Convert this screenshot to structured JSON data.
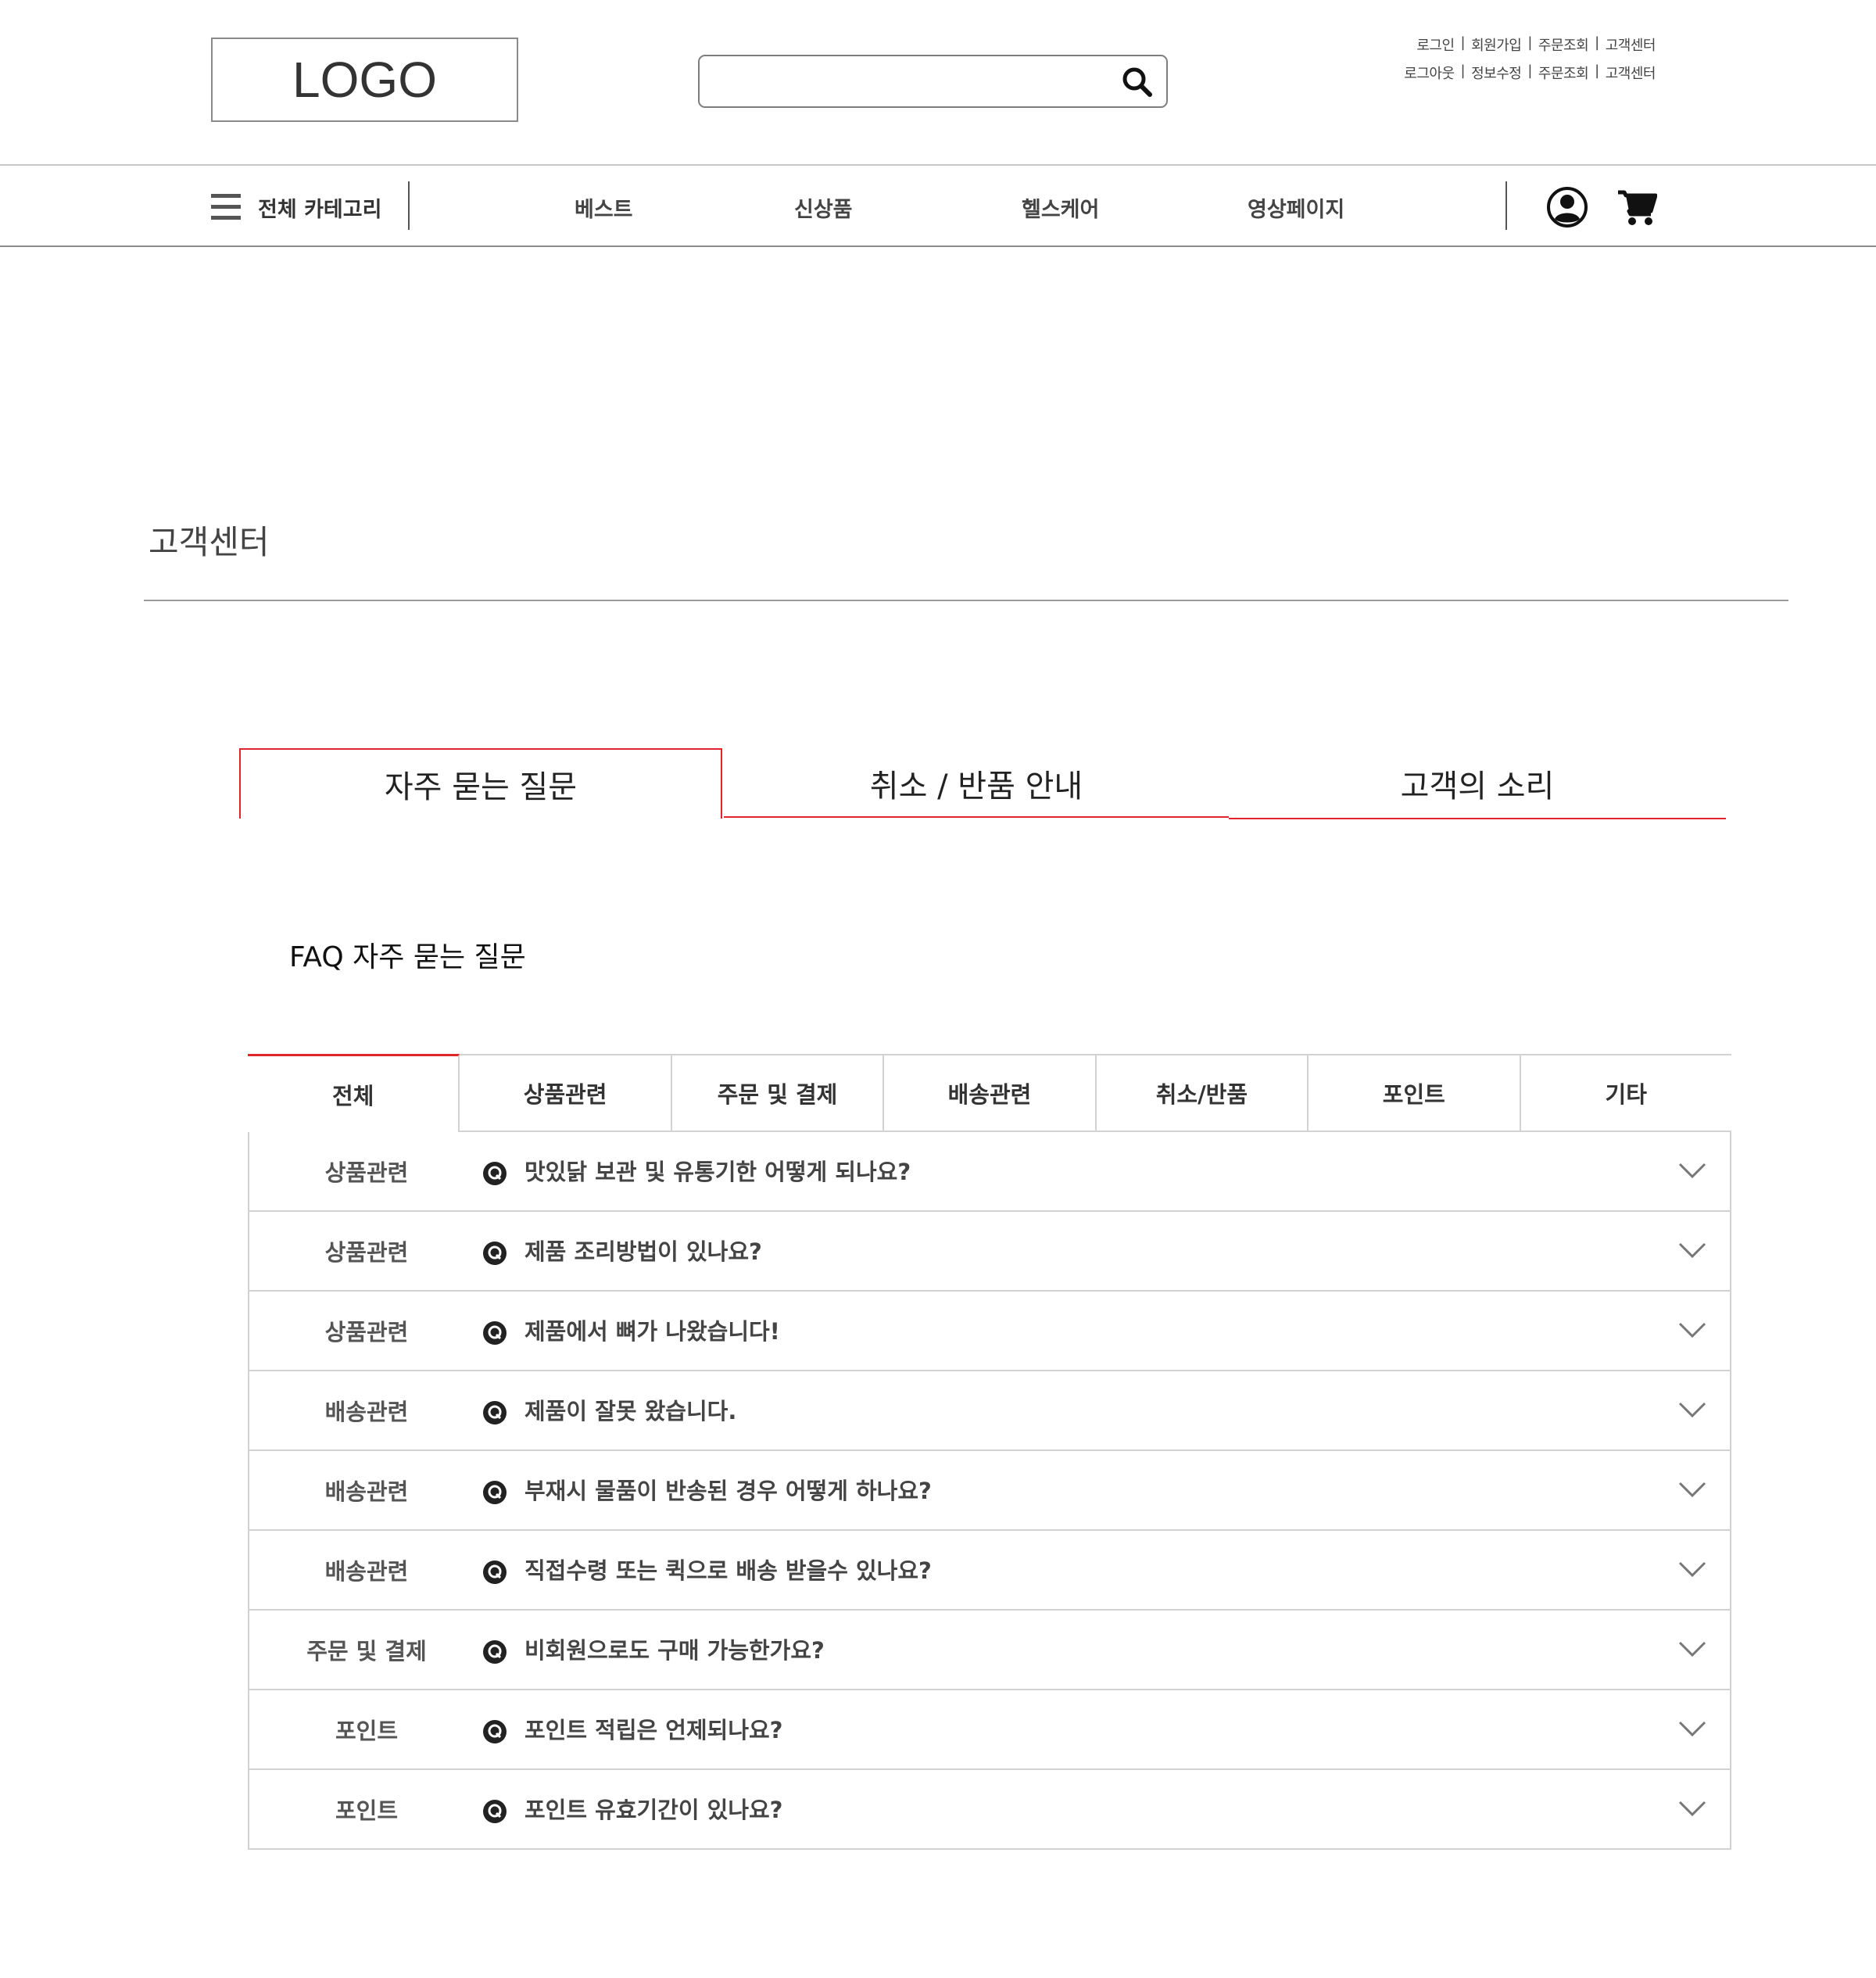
{
  "header": {
    "logo_text": "LOGO",
    "search_placeholder": "",
    "util_row1": [
      "로그인",
      "회원가입",
      "주문조회",
      "고객센터"
    ],
    "util_row2": [
      "로그아웃",
      "정보수정",
      "주문조회",
      "고객센터"
    ],
    "separator": "|"
  },
  "nav": {
    "category_label": "전체 카테고리",
    "items": [
      "베스트",
      "신상품",
      "헬스케어",
      "영상페이지"
    ]
  },
  "page": {
    "title": "고객센터"
  },
  "main_tabs": {
    "items": [
      "자주 묻는 질문",
      "취소 / 반품 안내",
      "고객의 소리"
    ],
    "active_index": 0
  },
  "faq": {
    "heading": "FAQ 자주 묻는 질문",
    "categories": [
      "전체",
      "상품관련",
      "주문 및 결제",
      "배송관련",
      "취소/반품",
      "포인트",
      "기타"
    ],
    "active_category": 0,
    "rows": [
      {
        "category": "상품관련",
        "question": "맛있닭 보관 및 유통기한 어떻게 되나요?"
      },
      {
        "category": "상품관련",
        "question": "제품 조리방법이 있나요?"
      },
      {
        "category": "상품관련",
        "question": "제품에서 뼈가 나왔습니다!"
      },
      {
        "category": "배송관련",
        "question": "제품이 잘못 왔습니다."
      },
      {
        "category": "배송관련",
        "question": "부재시 물품이 반송된 경우 어떻게 하나요?"
      },
      {
        "category": "배송관련",
        "question": "직접수령 또는 퀵으로 배송 받을수 있나요?"
      },
      {
        "category": "주문 및 결제",
        "question": "비회원으로도 구매 가능한가요?"
      },
      {
        "category": "포인트",
        "question": "포인트 적립은 언제되나요?"
      },
      {
        "category": "포인트",
        "question": "포인트 유효기간이 있나요?"
      }
    ]
  },
  "colors": {
    "accent": "#e0262b",
    "border": "#d2d2d2",
    "text": "#444444"
  },
  "icons": [
    "search-icon",
    "hamburger-menu-icon",
    "user-icon",
    "cart-icon",
    "q-icon",
    "chevron-down-icon"
  ]
}
